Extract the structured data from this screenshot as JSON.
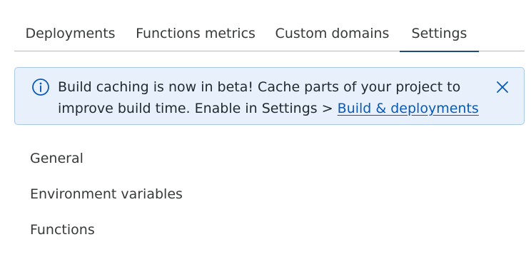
{
  "tabs": [
    {
      "label": "Deployments"
    },
    {
      "label": "Functions metrics"
    },
    {
      "label": "Custom domains"
    },
    {
      "label": "Settings"
    }
  ],
  "banner": {
    "message": "Build caching is now in beta! Cache parts of your project to improve build time. Enable in Settings > ",
    "link_label": "Build & deployments",
    "icon": "info-icon",
    "close_icon": "close-icon",
    "accent_color": "#0b59b5"
  },
  "settings_menu": {
    "items": [
      {
        "label": "General"
      },
      {
        "label": "Environment variables"
      },
      {
        "label": "Functions"
      }
    ]
  }
}
